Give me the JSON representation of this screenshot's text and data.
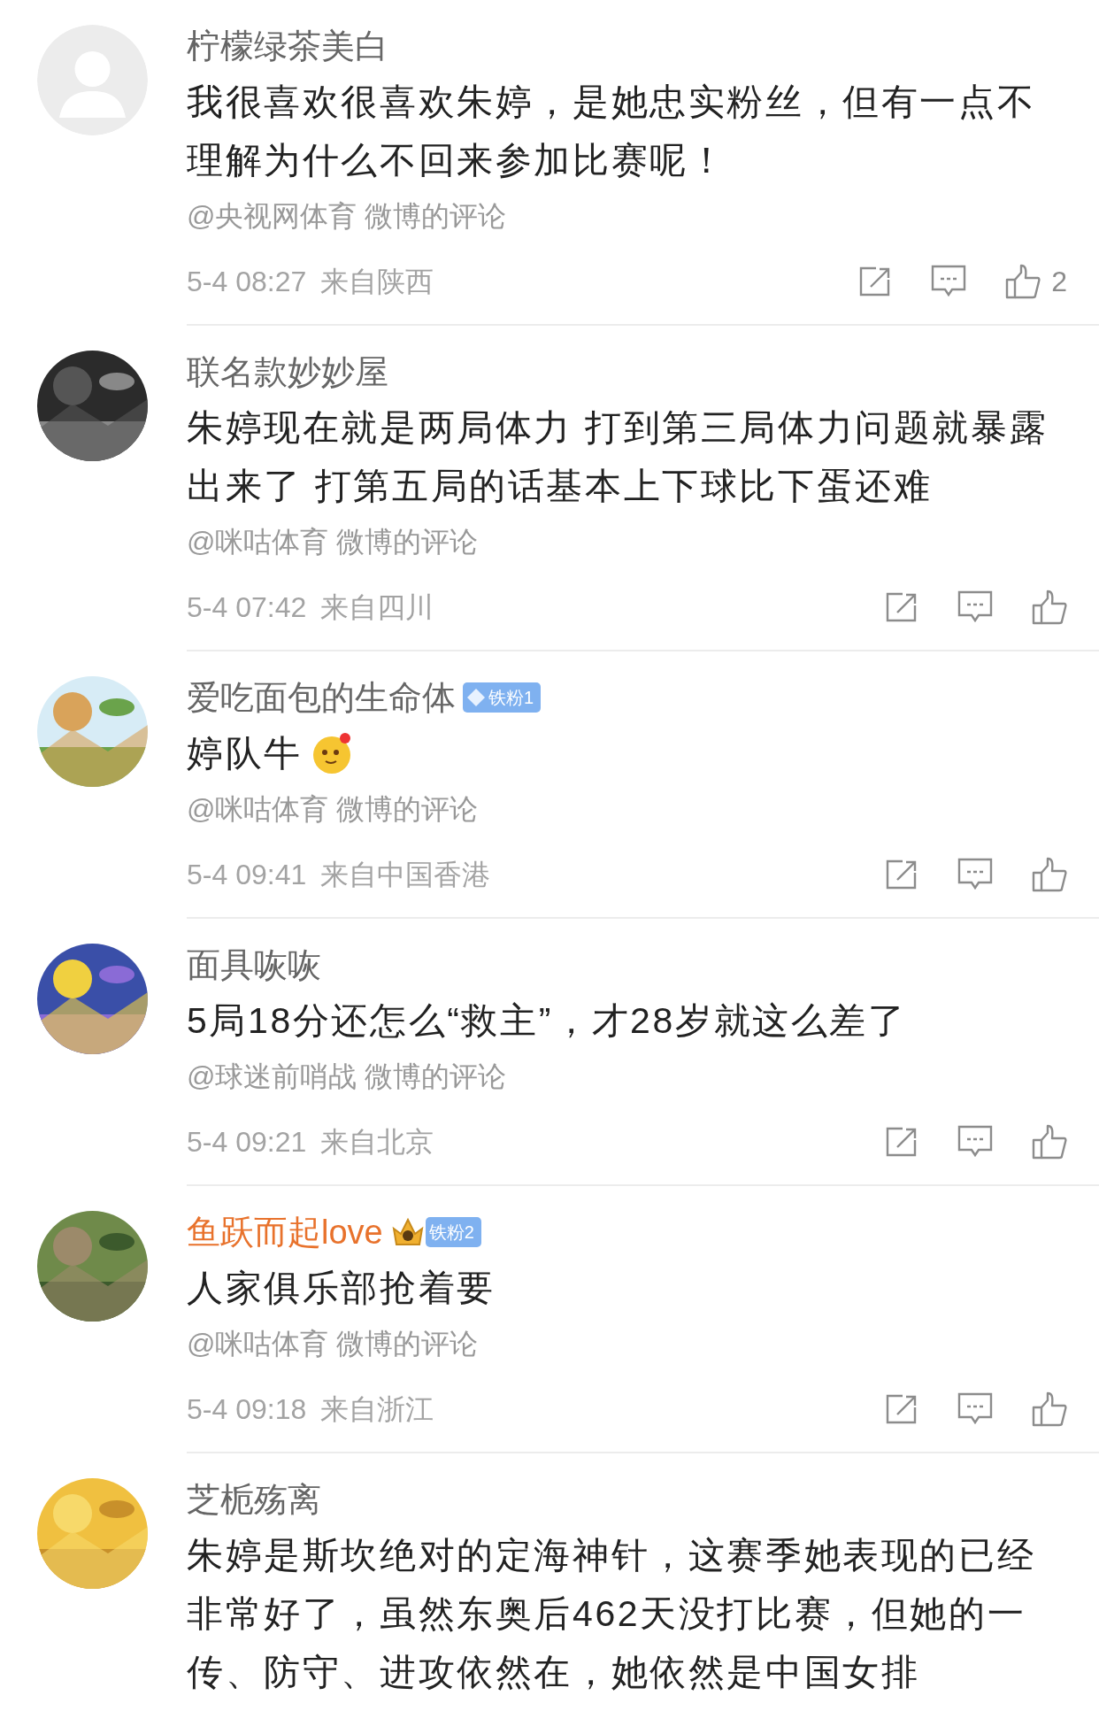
{
  "comments": [
    {
      "avatar": {
        "kind": "default"
      },
      "name": "柠檬绿茶美白",
      "highlighted": false,
      "text": "我很喜欢很喜欢朱婷，是她忠实粉丝，但有一点不理解为什么不回来参加比赛呢！",
      "emoji": false,
      "source": "@央视网体育 微博的评论",
      "time": "5-4 08:27",
      "location": "来自陕西",
      "likes": "2"
    },
    {
      "name": "联名款妙妙屋",
      "highlighted": false,
      "text": "朱婷现在就是两局体力 打到第三局体力问题就暴露出来了 打第五局的话基本上下球比下蛋还难",
      "emoji": false,
      "source": "@咪咕体育 微博的评论",
      "time": "5-4 07:42",
      "location": "来自四川"
    },
    {
      "name": "爱吃面包的生命体",
      "highlighted": false,
      "badge": {
        "kind": "diamond",
        "label": "铁粉1"
      },
      "text": "婷队牛",
      "emoji": true,
      "source": "@咪咕体育 微博的评论",
      "time": "5-4 09:41",
      "location": "来自中国香港"
    },
    {
      "name": "面具咴咴",
      "highlighted": false,
      "text": "5局18分还怎么“救主”，才28岁就这么差了",
      "emoji": false,
      "source": "@球迷前哨战 微博的评论",
      "time": "5-4 09:21",
      "location": "来自北京"
    },
    {
      "name": "鱼跃而起love",
      "highlighted": true,
      "badge": {
        "kind": "crown",
        "label": "铁粉2"
      },
      "text": "人家俱乐部抢着要",
      "emoji": false,
      "source": "@咪咕体育 微博的评论",
      "time": "5-4 09:18",
      "location": "来自浙江"
    },
    {
      "name": "芝栀殇离",
      "highlighted": false,
      "text": "朱婷是斯坎绝对的定海神针，这赛季她表现的已经非常好了，虽然东奥后462天没打比赛，但她的一传、防守、进攻依然在，她依然是中国女排",
      "emoji": false
    }
  ]
}
